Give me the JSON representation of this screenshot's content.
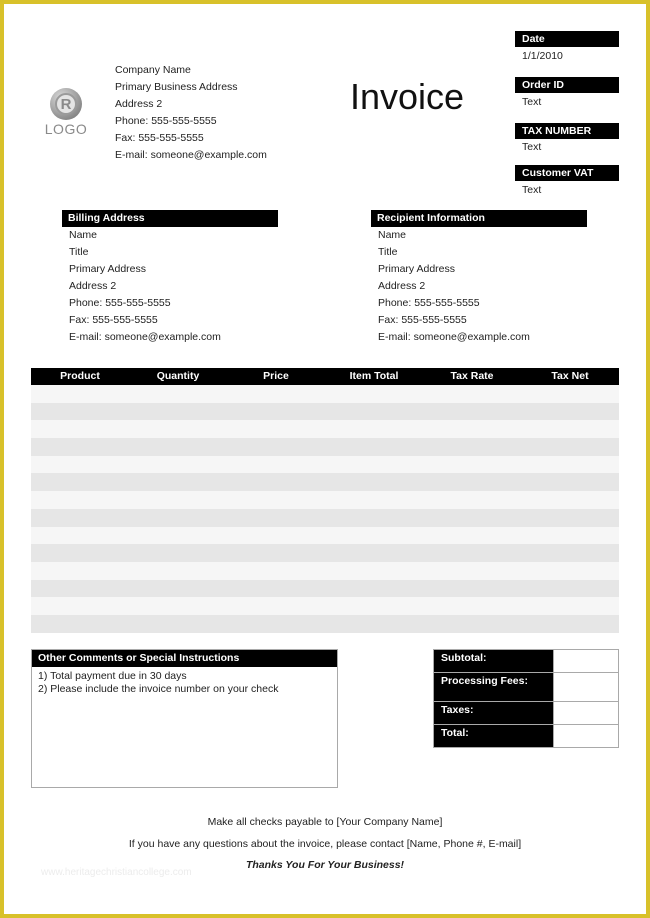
{
  "document": {
    "title": "Invoice",
    "logo_text": "LOGO",
    "logo_mark": "R"
  },
  "company": {
    "lines": [
      "Company Name",
      "Primary Business Address",
      "Address 2",
      "Phone: 555-555-5555",
      "Fax: 555-555-5555",
      "E-mail: someone@example.com"
    ]
  },
  "meta": [
    {
      "label": "Date",
      "value": "1/1/2010"
    },
    {
      "label": "Order ID",
      "value": "Text"
    },
    {
      "label": "TAX NUMBER",
      "value": "Text"
    },
    {
      "label": "Customer VAT",
      "value": "Text"
    }
  ],
  "billing": {
    "heading": "Billing Address",
    "lines": [
      "Name",
      "Title",
      "Primary Address",
      "Address 2",
      "Phone: 555-555-5555",
      "Fax: 555-555-5555",
      "E-mail: someone@example.com"
    ]
  },
  "recipient": {
    "heading": "Recipient Information",
    "lines": [
      "Name",
      "Title",
      "Primary Address",
      "Address 2",
      "Phone: 555-555-5555",
      "Fax: 555-555-5555",
      "E-mail: someone@example.com"
    ]
  },
  "items": {
    "columns": [
      "Product",
      "Quantity",
      "Price",
      "Item Total",
      "Tax Rate",
      "Tax Net"
    ],
    "rows": [
      [
        "",
        "",
        "",
        "",
        "",
        ""
      ],
      [
        "",
        "",
        "",
        "",
        "",
        ""
      ],
      [
        "",
        "",
        "",
        "",
        "",
        ""
      ],
      [
        "",
        "",
        "",
        "",
        "",
        ""
      ],
      [
        "",
        "",
        "",
        "",
        "",
        ""
      ],
      [
        "",
        "",
        "",
        "",
        "",
        ""
      ],
      [
        "",
        "",
        "",
        "",
        "",
        ""
      ],
      [
        "",
        "",
        "",
        "",
        "",
        ""
      ],
      [
        "",
        "",
        "",
        "",
        "",
        ""
      ],
      [
        "",
        "",
        "",
        "",
        "",
        ""
      ],
      [
        "",
        "",
        "",
        "",
        "",
        ""
      ],
      [
        "",
        "",
        "",
        "",
        "",
        ""
      ],
      [
        "",
        "",
        "",
        "",
        "",
        ""
      ],
      [
        "",
        "",
        "",
        "",
        "",
        ""
      ]
    ]
  },
  "comments": {
    "heading": "Other Comments or Special Instructions",
    "lines": [
      "1) Total payment due in 30 days",
      "2) Please include the invoice number on your check"
    ]
  },
  "totals": [
    {
      "label": "Subtotal:",
      "value": ""
    },
    {
      "label": "Processing Fees:",
      "value": ""
    },
    {
      "label": "Taxes:",
      "value": ""
    },
    {
      "label": "Total:",
      "value": ""
    }
  ],
  "footer": {
    "payable": "Make all checks payable to [Your Company Name]",
    "questions": "If you have any questions about the invoice, please contact [Name, Phone #, E-mail]",
    "thanks": "Thanks You For Your Business!",
    "watermark": "www.heritagechristiancollege.com"
  },
  "colors": {
    "frame": "#d8c12a",
    "header_bg": "#000000",
    "row_light": "#f6f6f6",
    "row_dark": "#e6e6e6"
  }
}
